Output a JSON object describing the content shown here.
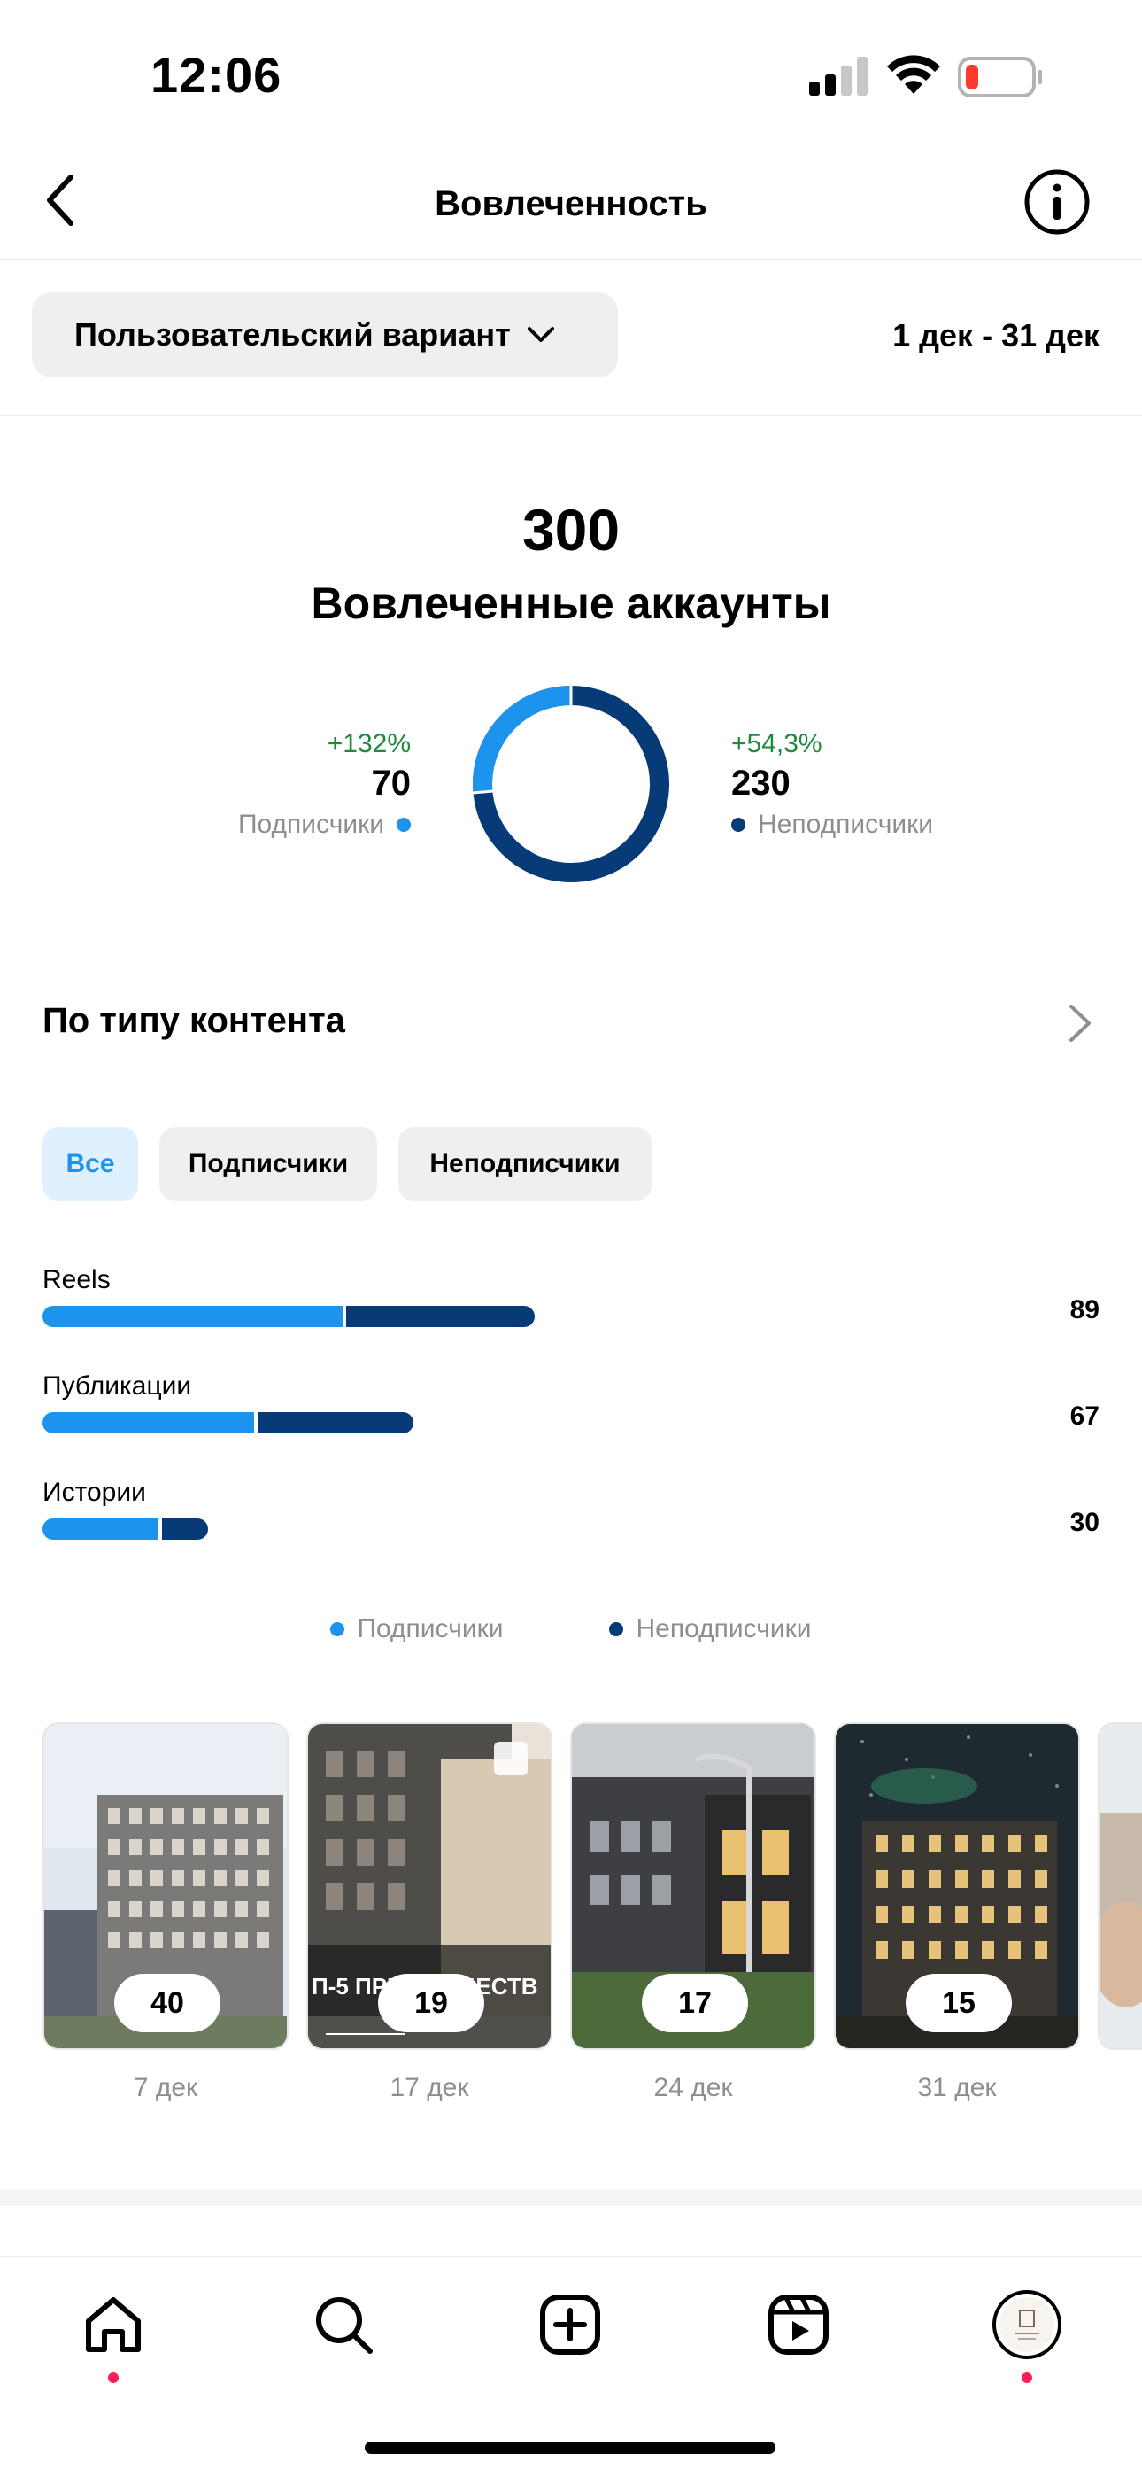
{
  "status_bar": {
    "time": "12:06"
  },
  "nav": {
    "title": "Вовлеченность",
    "back_icon": "chevron-left-icon",
    "info_icon": "info-icon"
  },
  "filter": {
    "range_label": "Пользовательский вариант",
    "date_range": "1 дек - 31 дек"
  },
  "summary": {
    "value": "300",
    "label": "Вовлеченные аккаунты",
    "followers": {
      "change": "+132%",
      "value": "70",
      "label": "Подписчики",
      "color": "#1c94ee"
    },
    "non_followers": {
      "change": "+54,3%",
      "value": "230",
      "label": "Неподписчики",
      "color": "#073b78"
    }
  },
  "content_type": {
    "title": "По типу контента",
    "tabs": [
      {
        "label": "Все",
        "active": true
      },
      {
        "label": "Подписчики",
        "active": false
      },
      {
        "label": "Неподписчики",
        "active": false
      }
    ]
  },
  "chart_data": {
    "type": "bar",
    "orientation": "horizontal",
    "stacked": true,
    "categories": [
      "Reels",
      "Публикации",
      "Истории"
    ],
    "totals": [
      89,
      67,
      30
    ],
    "series": [
      {
        "name": "Подписчики",
        "color": "#1c94ee",
        "share": [
          0.61,
          0.57,
          0.7
        ]
      },
      {
        "name": "Неподписчики",
        "color": "#073b78",
        "share": [
          0.39,
          0.43,
          0.3
        ]
      }
    ],
    "legend": "bottom-center"
  },
  "legend": {
    "followers": "Подписчики",
    "non_followers": "Неподписчики"
  },
  "thumbnails": [
    {
      "value": "40",
      "date": "7 дек"
    },
    {
      "value": "19",
      "date": "17 дек"
    },
    {
      "value": "17",
      "date": "24 дек"
    },
    {
      "value": "15",
      "date": "31 дек"
    }
  ],
  "thumb_overlay_text": "П-5 ПРЕИМУЩЕСТВ",
  "tab_bar": {
    "items": [
      "home-icon",
      "search-icon",
      "create-icon",
      "reels-icon",
      "profile-avatar"
    ]
  }
}
